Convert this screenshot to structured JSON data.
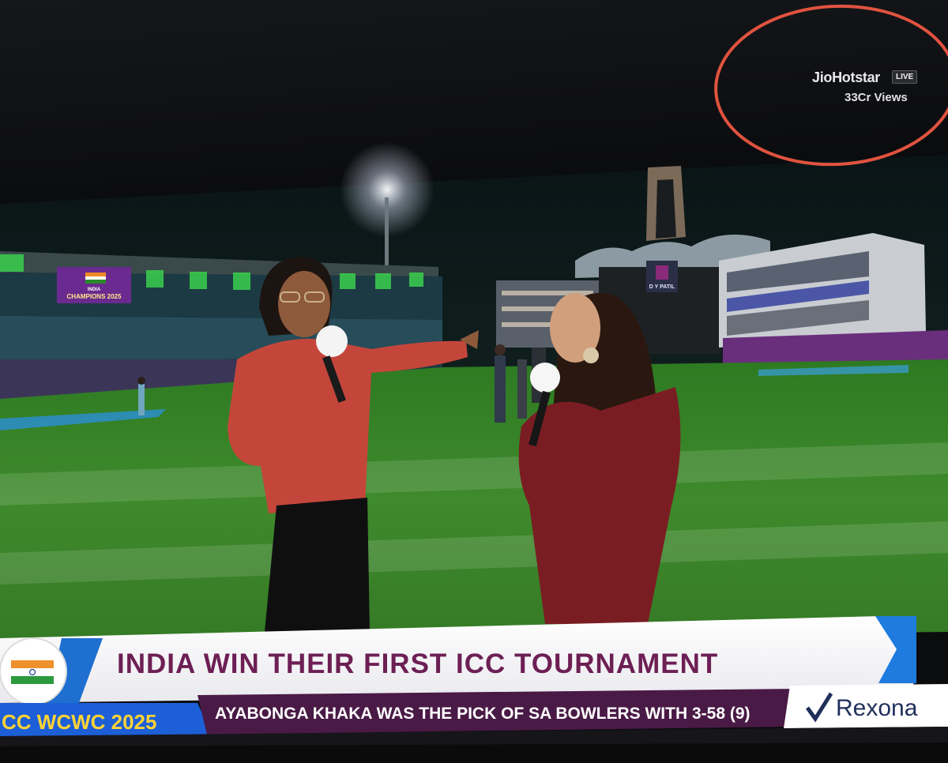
{
  "overlay": {
    "brand": "JioHotstar",
    "live_badge": "LIVE",
    "views": "33Cr Views"
  },
  "scoreboard_screen": {
    "line1": "INDIA",
    "line2": "CHAMPIONS 2025"
  },
  "stand_sign": {
    "line1": "D Y PATIL"
  },
  "ticker": {
    "headline": "INDIA WIN THEIR FIRST ICC TOURNAMENT",
    "event_label": "CC WCWC 2025",
    "subline": "AYABONGA KHAKA WAS THE PICK OF SA BOWLERS WITH 3-58 (9)",
    "sponsor": "Rexona"
  },
  "colors": {
    "headline_text": "#6d1f54",
    "event_label_text": "#ffd336",
    "subline_bar": "#4a1a46",
    "annotation_circle": "#e0533f",
    "pitch_green": "#3f8a2c"
  }
}
